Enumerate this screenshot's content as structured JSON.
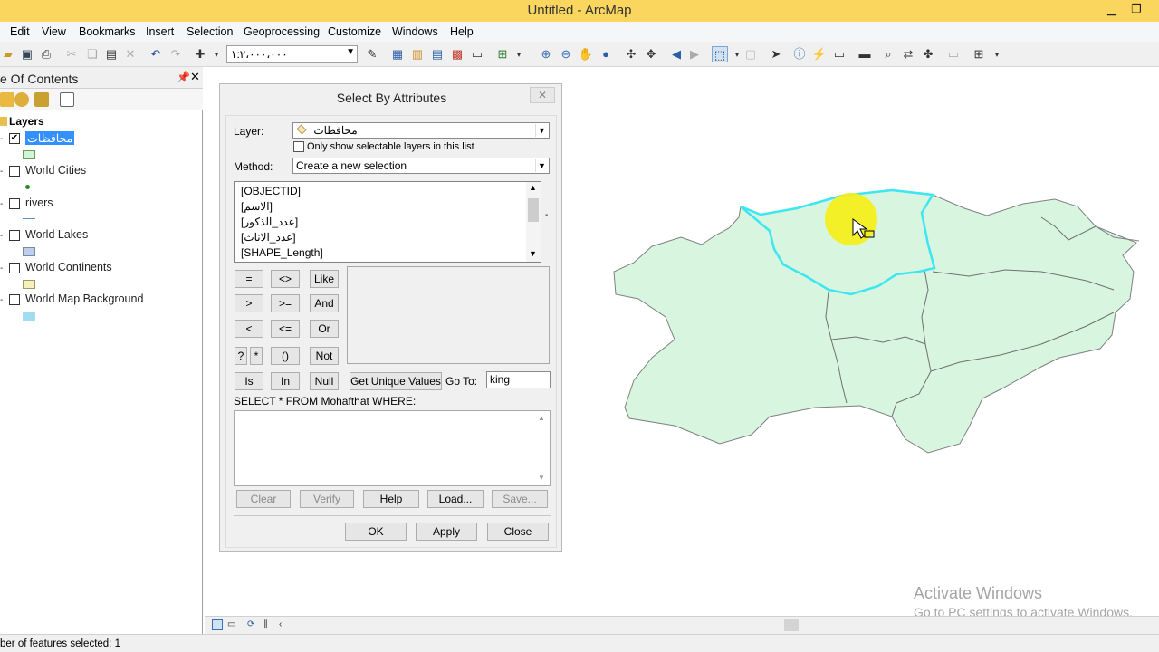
{
  "window": {
    "title": "Untitled - ArcMap"
  },
  "menu": [
    "Edit",
    "View",
    "Bookmarks",
    "Insert",
    "Selection",
    "Geoprocessing",
    "Customize",
    "Windows",
    "Help"
  ],
  "toolbar": {
    "scale_value": "١:٢،٠٠٠،٠٠٠"
  },
  "toc": {
    "title": "e Of Contents",
    "root": "Layers",
    "layers": [
      {
        "name": "محافظات",
        "checked": true,
        "symbol_color": "#d3f5d3"
      },
      {
        "name": "World Cities",
        "checked": false,
        "symbol_color": "#2a8a2a"
      },
      {
        "name": "rivers",
        "checked": false,
        "symbol_color": "#5b8fd6"
      },
      {
        "name": "World Lakes",
        "checked": false,
        "symbol_color": "#bcd0ec"
      },
      {
        "name": "World Continents",
        "checked": false,
        "symbol_color": "#f6f1b8"
      },
      {
        "name": "World Map Background",
        "checked": false,
        "symbol_color": "#a2dcf0"
      }
    ]
  },
  "dialog": {
    "title": "Select By Attributes",
    "layer_label": "Layer:",
    "layer_value": "محافظات",
    "only_selectable_label": "Only show selectable layers in this list",
    "method_label": "Method:",
    "method_value": "Create a new selection",
    "fields": [
      "[OBJECTID]",
      "[الاسم]",
      "[عدد_الذكور]",
      "[عدد_الاناث]",
      "[SHAPE_Length]"
    ],
    "operators": {
      "eq": "=",
      "ne": "<>",
      "like": "Like",
      "gt": ">",
      "ge": ">=",
      "and": "And",
      "lt": "<",
      "le": "<=",
      "or": "Or",
      "q": "?",
      "star": "*",
      "paren": "()",
      "not": "Not",
      "is": "Is",
      "in": "In",
      "null": "Null"
    },
    "get_unique_label": "Get Unique Values",
    "goto_label": "Go To:",
    "goto_value": "king",
    "sql_label": "SELECT * FROM Mohafthat WHERE:",
    "buttons": {
      "clear": "Clear",
      "verify": "Verify",
      "help": "Help",
      "load": "Load...",
      "save": "Save...",
      "ok": "OK",
      "apply": "Apply",
      "close": "Close"
    }
  },
  "status": {
    "text": "ber of features selected: 1"
  },
  "watermark": {
    "line1": "Activate Windows",
    "line2": "Go to PC settings to activate Windows."
  },
  "map": {
    "fill_color": "#d7f5df",
    "selected_outline": "#3ee6f2"
  }
}
